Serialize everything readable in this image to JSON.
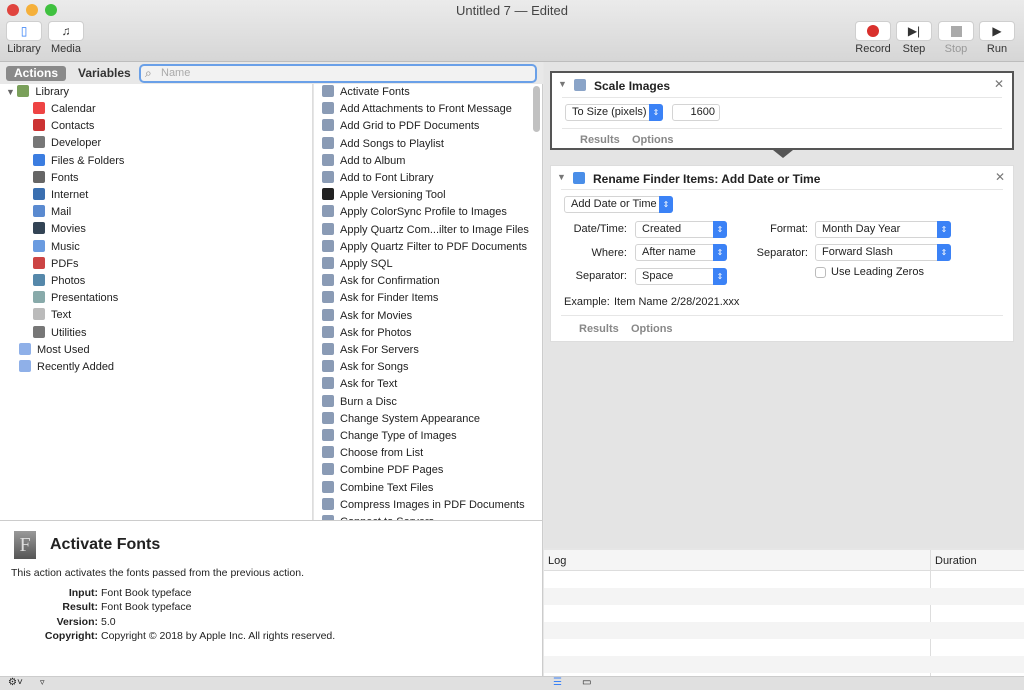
{
  "window": {
    "title": "Untitled 7 — Edited"
  },
  "toolbar": {
    "library": "Library",
    "media": "Media",
    "record": "Record",
    "step": "Step",
    "stop": "Stop",
    "run": "Run"
  },
  "tabs": {
    "actions": "Actions",
    "variables": "Variables"
  },
  "search": {
    "placeholder": "Name",
    "value": ""
  },
  "library": {
    "root": "Library",
    "items": [
      "Calendar",
      "Contacts",
      "Developer",
      "Files & Folders",
      "Fonts",
      "Internet",
      "Mail",
      "Movies",
      "Music",
      "PDFs",
      "Photos",
      "Presentations",
      "Text",
      "Utilities"
    ],
    "extras": [
      "Most Used",
      "Recently Added"
    ]
  },
  "actions": [
    "Activate Fonts",
    "Add Attachments to Front Message",
    "Add Grid to PDF Documents",
    "Add Songs to Playlist",
    "Add to Album",
    "Add to Font Library",
    "Apple Versioning Tool",
    "Apply ColorSync Profile to Images",
    "Apply Quartz Com...ilter to Image Files",
    "Apply Quartz Filter to PDF Documents",
    "Apply SQL",
    "Ask for Confirmation",
    "Ask for Finder Items",
    "Ask for Movies",
    "Ask for Photos",
    "Ask For Servers",
    "Ask for Songs",
    "Ask for Text",
    "Burn a Disc",
    "Change System Appearance",
    "Change Type of Images",
    "Choose from List",
    "Combine PDF Pages",
    "Combine Text Files",
    "Compress Images in PDF Documents",
    "Connect to Servers"
  ],
  "description": {
    "title": "Activate Fonts",
    "text": "This action activates the fonts passed from the previous action.",
    "input_label": "Input:",
    "input": "Font Book typeface",
    "result_label": "Result:",
    "result": "Font Book typeface",
    "version_label": "Version:",
    "version": "5.0",
    "copyright_label": "Copyright:",
    "copyright": "Copyright © 2018 by Apple Inc. All rights reserved."
  },
  "workflow": {
    "scale": {
      "title": "Scale Images",
      "mode": "To Size (pixels)",
      "size": "1600",
      "results": "Results",
      "options": "Options"
    },
    "rename": {
      "title": "Rename Finder Items: Add Date or Time",
      "mode": "Add Date or Time",
      "datetime_label": "Date/Time:",
      "datetime": "Created",
      "where_label": "Where:",
      "where": "After name",
      "sep_label": "Separator:",
      "sep": "Space",
      "format_label": "Format:",
      "format": "Month Day Year",
      "sep2_label": "Separator:",
      "sep2": "Forward Slash",
      "leading_zeros": "Use Leading Zeros",
      "leading_zeros_checked": false,
      "example_label": "Example:",
      "example": "Item Name 2/28/2021.xxx",
      "results": "Results",
      "options": "Options"
    }
  },
  "log": {
    "col_log": "Log",
    "col_duration": "Duration"
  },
  "colors": {
    "accent": "#3b82f6",
    "record": "#d9302c"
  }
}
